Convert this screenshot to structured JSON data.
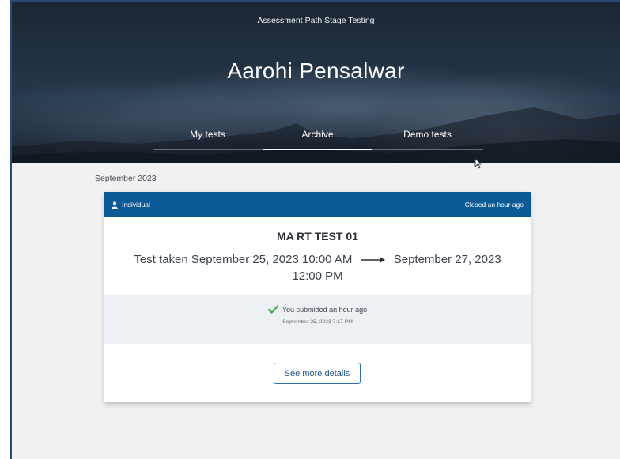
{
  "header": {
    "organization": "Assessment Path Stage Testing",
    "user_name": "Aarohi Pensalwar",
    "tabs": [
      {
        "label": "My tests",
        "active": false
      },
      {
        "label": "Archive",
        "active": true
      },
      {
        "label": "Demo tests",
        "active": false
      }
    ]
  },
  "archive": {
    "month_label": "September 2023",
    "card": {
      "type_label": "Individual",
      "status": "Closed an hour ago",
      "title": "MA RT TEST 01",
      "taken_prefix": "Test taken",
      "start": "September 25, 2023 10:00 AM",
      "end": "September 27, 2023 12:00 PM",
      "submitted_text": "You submitted an hour ago",
      "submitted_time": "September 25, 2023 7:17 PM",
      "details_button": "See more details"
    }
  },
  "colors": {
    "card_header": "#0a5a96",
    "check": "#4caf50",
    "button_border": "#2f6fa8"
  },
  "icons": {
    "individual": "user-icon",
    "submitted": "checkmark-icon",
    "range": "arrow-right-icon"
  }
}
